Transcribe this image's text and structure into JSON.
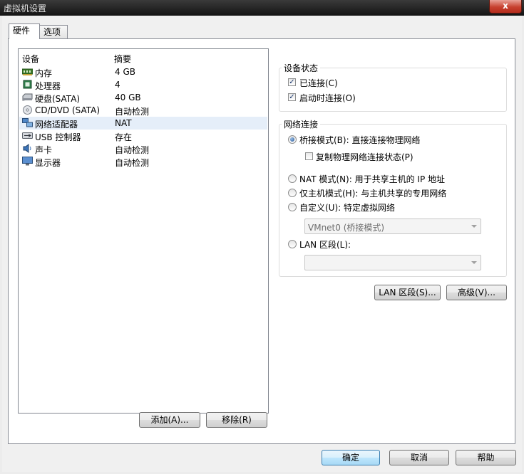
{
  "window": {
    "title": "虚拟机设置",
    "close_label": "x"
  },
  "tabs": [
    {
      "label": "硬件"
    },
    {
      "label": "选项"
    }
  ],
  "device_list": {
    "headers": {
      "device": "设备",
      "summary": "摘要"
    },
    "items": [
      {
        "name": "内存",
        "summary": "4 GB",
        "icon": "memory-icon"
      },
      {
        "name": "处理器",
        "summary": "4",
        "icon": "processor-icon"
      },
      {
        "name": "硬盘(SATA)",
        "summary": "40 GB",
        "icon": "hard-disk-icon"
      },
      {
        "name": "CD/DVD (SATA)",
        "summary": "自动检测",
        "icon": "cd-dvd-icon"
      },
      {
        "name": "网络适配器",
        "summary": "NAT",
        "icon": "network-adapter-icon"
      },
      {
        "name": "USB 控制器",
        "summary": "存在",
        "icon": "usb-icon"
      },
      {
        "name": "声卡",
        "summary": "自动检测",
        "icon": "sound-card-icon"
      },
      {
        "name": "显示器",
        "summary": "自动检测",
        "icon": "display-icon"
      }
    ],
    "selected_index": 4
  },
  "list_buttons": {
    "add": "添加(A)...",
    "remove": "移除(R)"
  },
  "device_status": {
    "title": "设备状态",
    "connected": {
      "label": "已连接(C)",
      "checked": true
    },
    "connect_at_power_on": {
      "label": "启动时连接(O)",
      "checked": true
    }
  },
  "network_connection": {
    "title": "网络连接",
    "bridged": {
      "label": "桥接模式(B): 直接连接物理网络",
      "selected": true
    },
    "replicate": {
      "label": "复制物理网络连接状态(P)",
      "checked": false
    },
    "nat": {
      "label": "NAT 模式(N): 用于共享主机的 IP 地址",
      "selected": false
    },
    "host_only": {
      "label": "仅主机模式(H): 与主机共享的专用网络",
      "selected": false
    },
    "custom": {
      "label": "自定义(U): 特定虚拟网络",
      "selected": false
    },
    "custom_select_value": "VMnet0 (桥接模式)",
    "lan_segment": {
      "label": "LAN 区段(L):",
      "selected": false
    },
    "lan_select_value": ""
  },
  "network_buttons": {
    "lan_segments": "LAN 区段(S)...",
    "advanced": "高级(V)..."
  },
  "dialog_buttons": {
    "ok": "确定",
    "cancel": "取消",
    "help": "帮助"
  }
}
